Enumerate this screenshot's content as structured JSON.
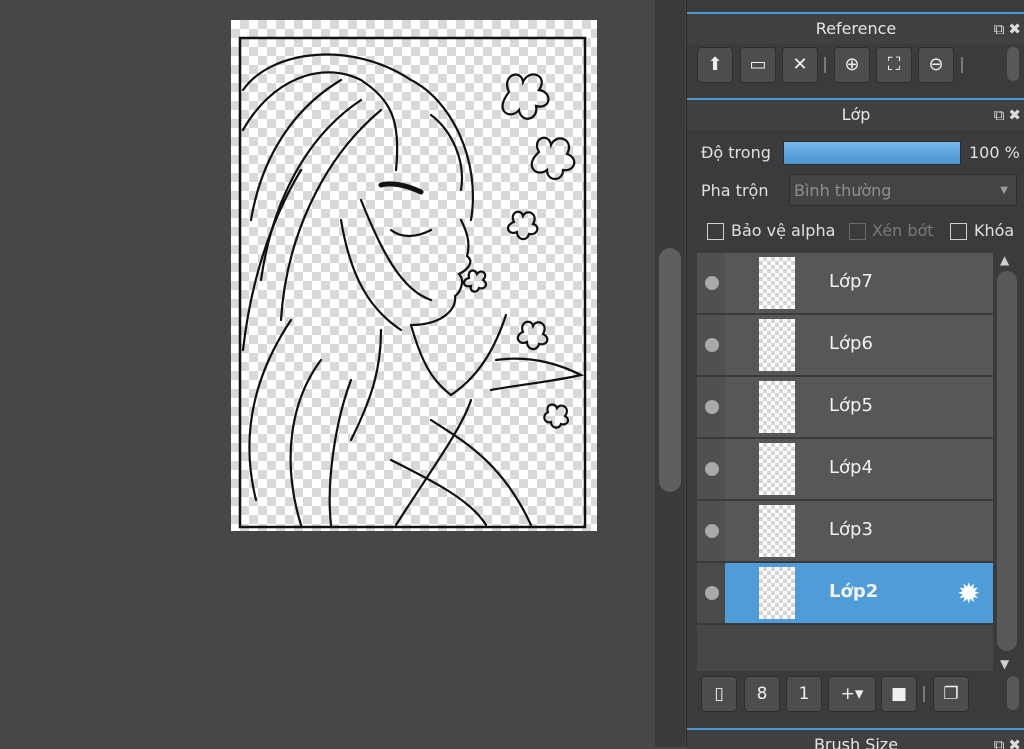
{
  "reference_panel": {
    "title": "Reference",
    "toolbar": [
      {
        "icon": "cloud-upload-icon",
        "glyph": "⬆"
      },
      {
        "icon": "folder-open-icon",
        "glyph": "▭"
      },
      {
        "icon": "close-icon",
        "glyph": "✕"
      },
      {
        "icon": "zoom-in-icon",
        "glyph": "⊕"
      },
      {
        "icon": "fit-screen-icon",
        "glyph": "⛶"
      },
      {
        "icon": "zoom-out-icon",
        "glyph": "⊖"
      }
    ]
  },
  "layer_panel": {
    "title": "Lớp",
    "opacity_label": "Độ trong",
    "opacity_value": "100 %",
    "opacity_fraction": 1.0,
    "blend_label": "Pha trộn",
    "blend_value": "Bình thường",
    "options": {
      "protect_alpha": "Bảo vệ alpha",
      "clipping": "Xén bớt",
      "lock": "Khóa"
    },
    "layers": [
      {
        "name": "Lớp7",
        "selected": false
      },
      {
        "name": "Lớp6",
        "selected": false
      },
      {
        "name": "Lớp5",
        "selected": false
      },
      {
        "name": "Lớp4",
        "selected": false
      },
      {
        "name": "Lớp3",
        "selected": false
      },
      {
        "name": "Lớp2",
        "selected": true
      }
    ],
    "bottom_toolbar": [
      {
        "icon": "new-layer-icon",
        "glyph": "▯"
      },
      {
        "icon": "new-8bit-layer-icon",
        "glyph": "8"
      },
      {
        "icon": "new-1bit-layer-icon",
        "glyph": "1"
      },
      {
        "icon": "add-layer-menu-icon",
        "glyph": "+▾"
      },
      {
        "icon": "folder-icon",
        "glyph": "■"
      },
      {
        "icon": "duplicate-layer-icon",
        "glyph": "❐"
      }
    ]
  },
  "next_panel": {
    "title": "Brush Size"
  },
  "colors": {
    "accent": "#4f9cd8",
    "panel_bg": "#3b3b3b",
    "canvas_bg": "#474747"
  }
}
